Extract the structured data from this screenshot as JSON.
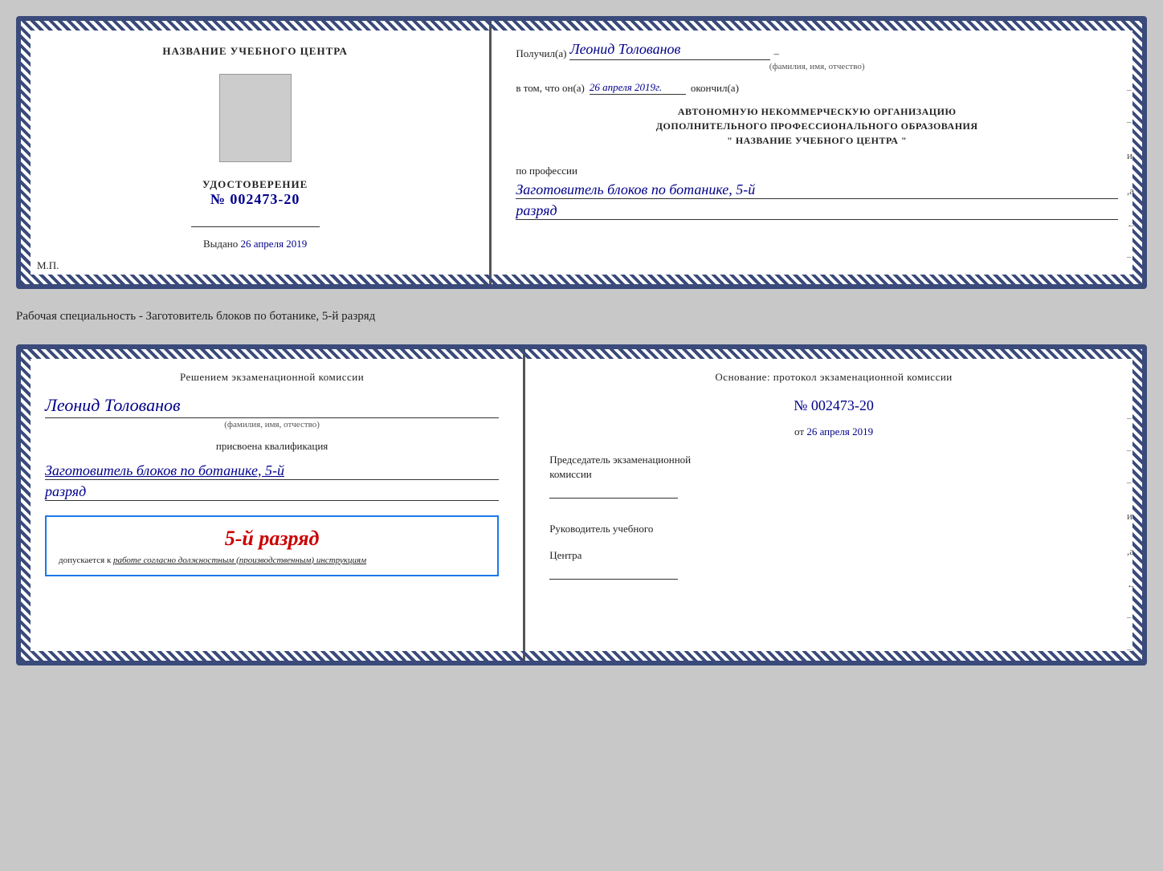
{
  "upper_cert": {
    "left": {
      "title": "НАЗВАНИЕ УЧЕБНОГО ЦЕНТРА",
      "udost_label": "УДОСТОВЕРЕНИЕ",
      "udost_number": "№ 002473-20",
      "vydano_label": "Выдано",
      "vydano_date": "26 апреля 2019",
      "mp_label": "М.П."
    },
    "right": {
      "poluchil_prefix": "Получил(а)",
      "poluchil_name": "Леонид Толованов",
      "fio_subtext": "(фамилия, имя, отчество)",
      "vtom_prefix": "в том, что он(а)",
      "vtom_date": "26 апреля 2019г.",
      "okonchill": "окончил(а)",
      "avtonom_line1": "АВТОНОМНУЮ НЕКОММЕРЧЕСКУЮ ОРГАНИЗАЦИЮ",
      "avtonom_line2": "ДОПОЛНИТЕЛЬНОГО ПРОФЕССИОНАЛЬНОГО ОБРАЗОВАНИЯ",
      "avtonom_quotes": "\"  НАЗВАНИЕ УЧЕБНОГО ЦЕНТРА  \"",
      "profess_label": "по профессии",
      "profess_value": "Заготовитель блоков по ботанике, 5-й",
      "razryad_value": "разряд"
    }
  },
  "specialty_text": "Рабочая специальность - Заготовитель блоков по ботанике, 5-й разряд",
  "lower_cert": {
    "left": {
      "resheniem": "Решением экзаменационной комиссии",
      "komissia_name": "Леонид Толованов",
      "fio_subtext": "(фамилия, имя, отчество)",
      "prisvoena": "присвоена квалификация",
      "kvalif_value": "Заготовитель блоков по ботанике, 5-й",
      "razryad_value": "разряд",
      "stamp_rank": "5-й разряд",
      "dopusk_prefix": "допускается к",
      "dopusk_text": "работе согласно должностным (производственным) инструкциям"
    },
    "right": {
      "osnovanie": "Основание: протокол экзаменационной комиссии",
      "proto_number": "№  002473-20",
      "ot_label": "от",
      "ot_date": "26 апреля 2019",
      "predsedatel_line1": "Председатель экзаменационной",
      "predsedatel_line2": "комиссии",
      "rukovod_line1": "Руководитель учебного",
      "rukovod_line2": "Центра"
    }
  }
}
